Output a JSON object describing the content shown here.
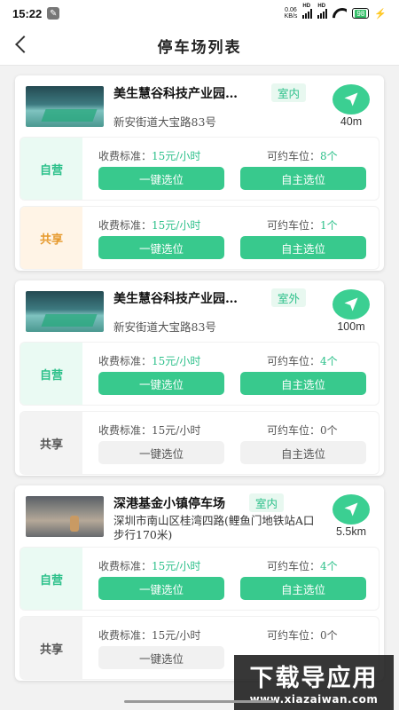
{
  "status_bar": {
    "time": "15:22",
    "net_speed_value": "0.06",
    "net_speed_unit": "KB/s",
    "signal_label_1": "HD",
    "signal_label_2": "HD",
    "battery": "98",
    "icons": [
      "wrench-icon",
      "signal-icon",
      "wifi-icon",
      "battery-icon",
      "charging-icon"
    ]
  },
  "header": {
    "title": "停车场列表",
    "back_icon": "back-arrow-icon"
  },
  "lots": [
    {
      "name": "美生慧谷科技产业园…",
      "tag": "室内",
      "address": "新安街道大宝路83号",
      "distance": "40m",
      "spots": [
        {
          "type": "自营",
          "style": "self",
          "fee_label": "收费标准：",
          "fee": "15元/小时",
          "avail_label": "可约车位：",
          "avail": "8个",
          "btn1": "一键选位",
          "btn2": "自主选位",
          "enabled": true
        },
        {
          "type": "共享",
          "style": "share",
          "fee_label": "收费标准：",
          "fee": "15元/小时",
          "avail_label": "可约车位：",
          "avail": "1个",
          "btn1": "一键选位",
          "btn2": "自主选位",
          "enabled": true
        }
      ]
    },
    {
      "name": "美生慧谷科技产业园…",
      "tag": "室外",
      "address": "新安街道大宝路83号",
      "distance": "100m",
      "spots": [
        {
          "type": "自营",
          "style": "self",
          "fee_label": "收费标准：",
          "fee": "15元/小时",
          "avail_label": "可约车位：",
          "avail": "4个",
          "btn1": "一键选位",
          "btn2": "自主选位",
          "enabled": true
        },
        {
          "type": "共享",
          "style": "off",
          "fee_label": "收费标准：",
          "fee": "15元/小时",
          "avail_label": "可约车位：",
          "avail": "0个",
          "btn1": "一键选位",
          "btn2": "自主选位",
          "enabled": false
        }
      ]
    },
    {
      "name": "深港基金小镇停车场",
      "tag": "室内",
      "address": "深圳市南山区桂湾四路(鲤鱼门地铁站A口步行170米)",
      "distance": "5.5km",
      "spots": [
        {
          "type": "自营",
          "style": "self",
          "fee_label": "收费标准：",
          "fee": "15元/小时",
          "avail_label": "可约车位：",
          "avail": "4个",
          "btn1": "一键选位",
          "btn2": "自主选位",
          "enabled": true
        },
        {
          "type": "共享",
          "style": "off",
          "fee_label": "收费标准：",
          "fee": "15元/小时",
          "avail_label": "可约车位：",
          "avail": "0个",
          "btn1": "一键选位",
          "btn2": "",
          "enabled": false
        }
      ]
    }
  ],
  "watermark": {
    "title": "下载导应用",
    "url": "www.xiazaiwan.com"
  },
  "colors": {
    "accent": "#38c98d",
    "share": "#e69a2e",
    "background": "#f2f2f2"
  }
}
